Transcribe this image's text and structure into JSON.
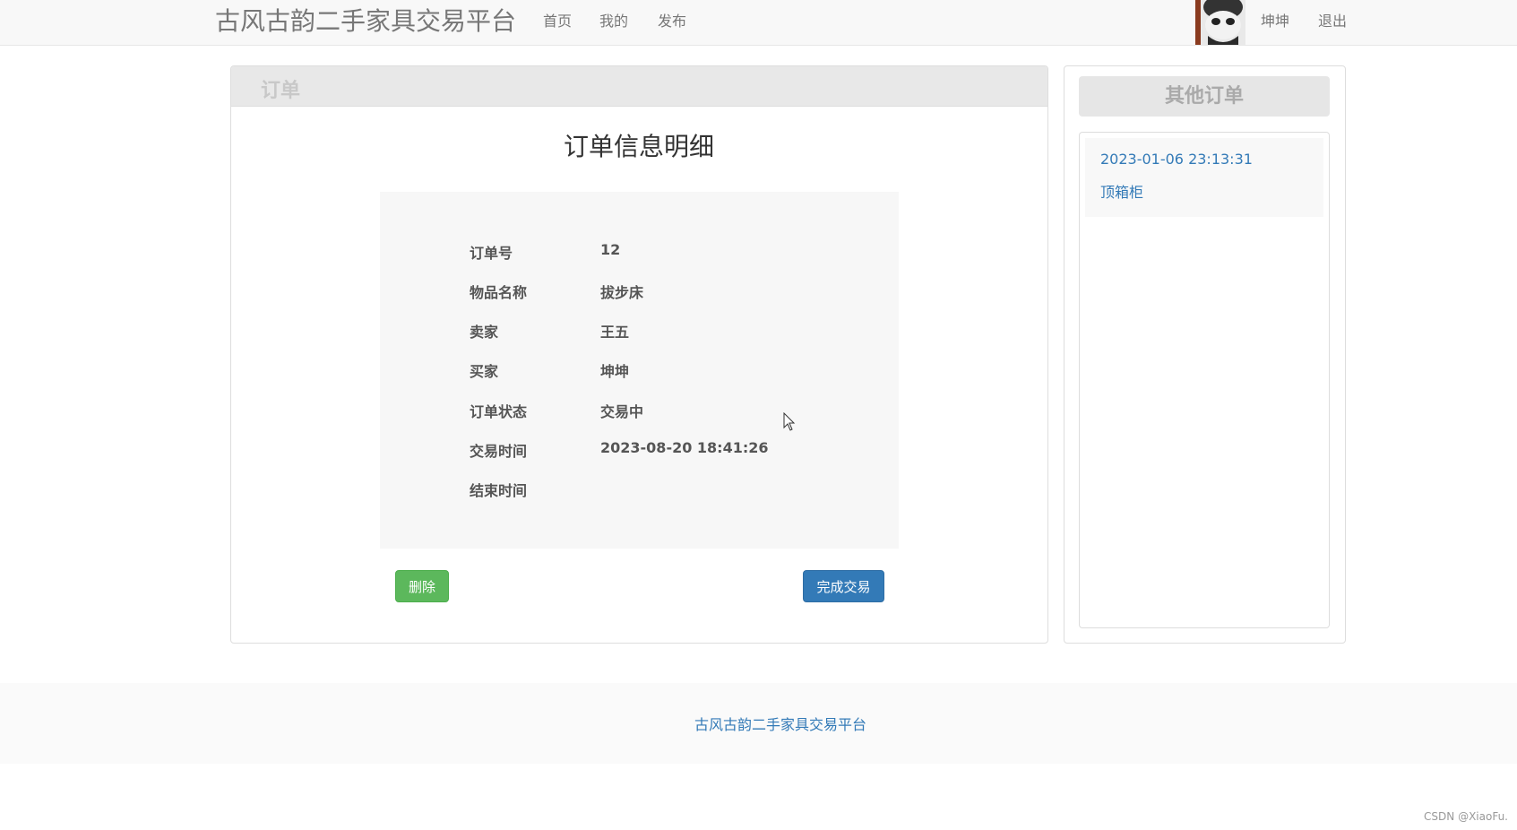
{
  "navbar": {
    "brand": "古风古韵二手家具交易平台",
    "links": [
      "首页",
      "我的",
      "发布"
    ],
    "username": "坤坤",
    "logout": "退出"
  },
  "order_panel": {
    "heading": "订单",
    "title": "订单信息明细",
    "rows": [
      {
        "label": "订单号",
        "value": "12"
      },
      {
        "label": "物品名称",
        "value": "拔步床"
      },
      {
        "label": "卖家",
        "value": "王五"
      },
      {
        "label": "买家",
        "value": "坤坤"
      },
      {
        "label": "订单状态",
        "value": "交易中"
      },
      {
        "label": "交易时间",
        "value": "2023-08-20 18:41:26"
      },
      {
        "label": "结束时间",
        "value": ""
      }
    ],
    "delete_button": "删除",
    "complete_button": "完成交易"
  },
  "sidebar": {
    "heading": "其他订单",
    "items": [
      {
        "time": "2023-01-06 23:13:31",
        "name": "顶箱柜"
      }
    ]
  },
  "footer": {
    "text": "古风古韵二手家具交易平台"
  },
  "watermark": "CSDN @XiaoFu.",
  "colors": {
    "primary": "#337ab7",
    "success": "#5cb85c"
  }
}
